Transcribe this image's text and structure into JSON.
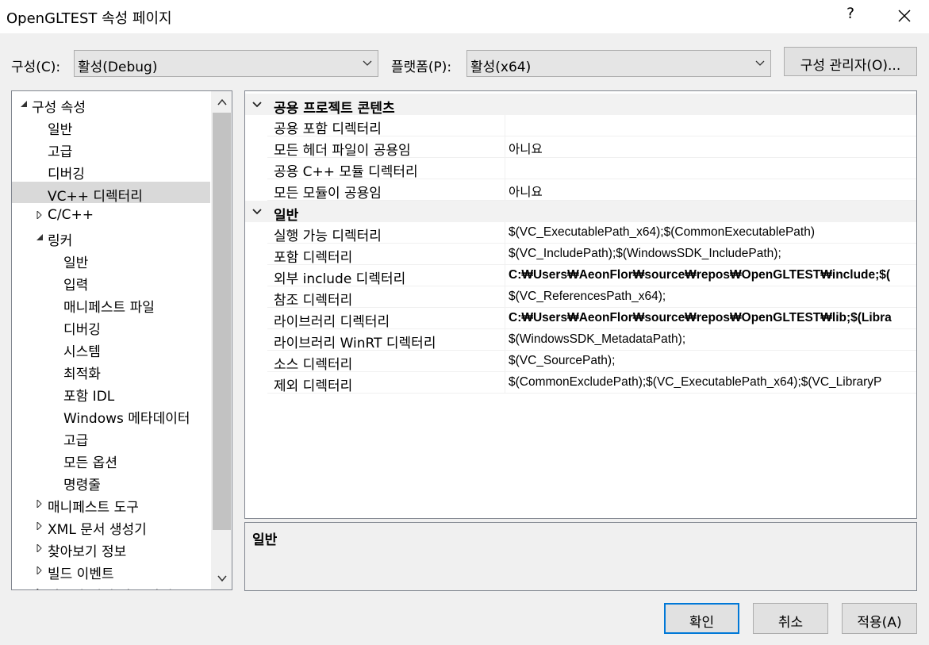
{
  "window": {
    "title": "OpenGLTEST 속성 페이지",
    "help_label": "?"
  },
  "toolbar": {
    "config_label": "구성(C):",
    "config_value": "활성(Debug)",
    "platform_label": "플랫폼(P):",
    "platform_value": "활성(x64)",
    "config_manager_label": "구성 관리자(O)..."
  },
  "tree": {
    "items": [
      {
        "label": "구성 속성",
        "level": 0,
        "state": "expanded"
      },
      {
        "label": "일반",
        "level": 1,
        "state": "leaf"
      },
      {
        "label": "고급",
        "level": 1,
        "state": "leaf"
      },
      {
        "label": "디버깅",
        "level": 1,
        "state": "leaf"
      },
      {
        "label": "VC++ 디렉터리",
        "level": 1,
        "state": "leaf",
        "selected": true
      },
      {
        "label": "C/C++",
        "level": 1,
        "state": "collapsed"
      },
      {
        "label": "링커",
        "level": 1,
        "state": "expanded"
      },
      {
        "label": "일반",
        "level": 2,
        "state": "leaf"
      },
      {
        "label": "입력",
        "level": 2,
        "state": "leaf"
      },
      {
        "label": "매니페스트 파일",
        "level": 2,
        "state": "leaf"
      },
      {
        "label": "디버깅",
        "level": 2,
        "state": "leaf"
      },
      {
        "label": "시스템",
        "level": 2,
        "state": "leaf"
      },
      {
        "label": "최적화",
        "level": 2,
        "state": "leaf"
      },
      {
        "label": "포함 IDL",
        "level": 2,
        "state": "leaf"
      },
      {
        "label": "Windows 메타데이터",
        "level": 2,
        "state": "leaf"
      },
      {
        "label": "고급",
        "level": 2,
        "state": "leaf"
      },
      {
        "label": "모든 옵션",
        "level": 2,
        "state": "leaf"
      },
      {
        "label": "명령줄",
        "level": 2,
        "state": "leaf"
      },
      {
        "label": "매니페스트 도구",
        "level": 1,
        "state": "collapsed"
      },
      {
        "label": "XML 문서 생성기",
        "level": 1,
        "state": "collapsed"
      },
      {
        "label": "찾아보기 정보",
        "level": 1,
        "state": "collapsed"
      },
      {
        "label": "빌드 이벤트",
        "level": 1,
        "state": "collapsed"
      },
      {
        "label": "사용자 지정 빌드 단계",
        "level": 1,
        "state": "collapsed"
      }
    ]
  },
  "grid": {
    "categories": [
      {
        "label": "공용 프로젝트 콘텐츠",
        "rows": [
          {
            "name": "공용 포함 디렉터리",
            "value": "",
            "bold": false
          },
          {
            "name": "모든 헤더 파일이 공용임",
            "value": "아니요",
            "bold": false
          },
          {
            "name": "공용 C++ 모듈 디렉터리",
            "value": "",
            "bold": false
          },
          {
            "name": "모든 모듈이 공용임",
            "value": "아니요",
            "bold": false
          }
        ]
      },
      {
        "label": "일반",
        "rows": [
          {
            "name": "실행 가능 디렉터리",
            "value": "$(VC_ExecutablePath_x64);$(CommonExecutablePath)",
            "bold": false
          },
          {
            "name": "포함 디렉터리",
            "value": "$(VC_IncludePath);$(WindowsSDK_IncludePath);",
            "bold": false
          },
          {
            "name": "외부 include 디렉터리",
            "value": "C:₩Users₩AeonFlor₩source₩repos₩OpenGLTEST₩include;$(",
            "bold": true
          },
          {
            "name": "참조 디렉터리",
            "value": "$(VC_ReferencesPath_x64);",
            "bold": false
          },
          {
            "name": "라이브러리 디렉터리",
            "value": "C:₩Users₩AeonFlor₩source₩repos₩OpenGLTEST₩lib;$(Libra",
            "bold": true
          },
          {
            "name": "라이브러리 WinRT 디렉터리",
            "value": "$(WindowsSDK_MetadataPath);",
            "bold": false
          },
          {
            "name": "소스 디렉터리",
            "value": "$(VC_SourcePath);",
            "bold": false
          },
          {
            "name": "제외 디렉터리",
            "value": "$(CommonExcludePath);$(VC_ExecutablePath_x64);$(VC_LibraryP",
            "bold": false
          }
        ]
      }
    ]
  },
  "description": {
    "title": "일반"
  },
  "buttons": {
    "ok": "확인",
    "cancel": "취소",
    "apply": "적용(A)"
  }
}
